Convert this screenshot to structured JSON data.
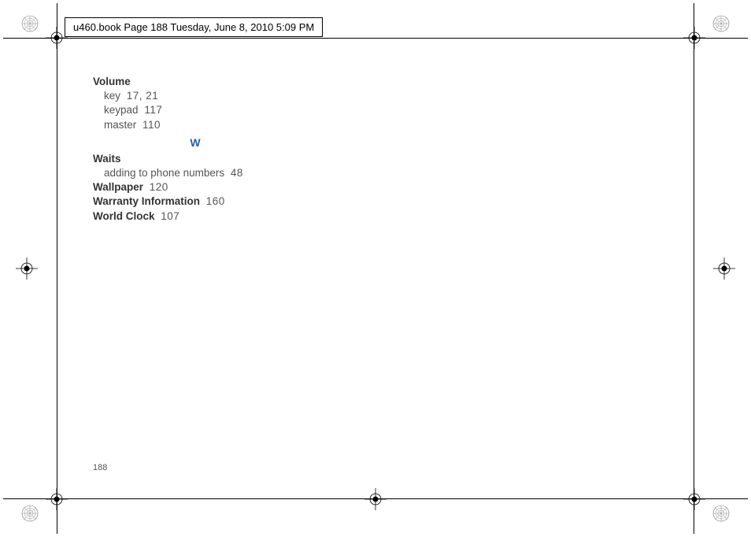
{
  "header": {
    "text": "u460.book  Page 188  Tuesday, June 8, 2010  5:09 PM"
  },
  "index": {
    "volume": {
      "title": "Volume",
      "key_label": "key",
      "key_pages": "17, 21",
      "keypad_label": "keypad",
      "keypad_page": "117",
      "master_label": "master",
      "master_page": "110"
    },
    "section_letter": "W",
    "waits": {
      "title": "Waits",
      "sub_label": "adding to phone numbers",
      "sub_page": "48"
    },
    "wallpaper": {
      "title": "Wallpaper",
      "page": "120"
    },
    "warranty": {
      "title": "Warranty Information",
      "page": "160"
    },
    "worldclock": {
      "title": "World Clock",
      "page": "107"
    }
  },
  "page_number": "188"
}
